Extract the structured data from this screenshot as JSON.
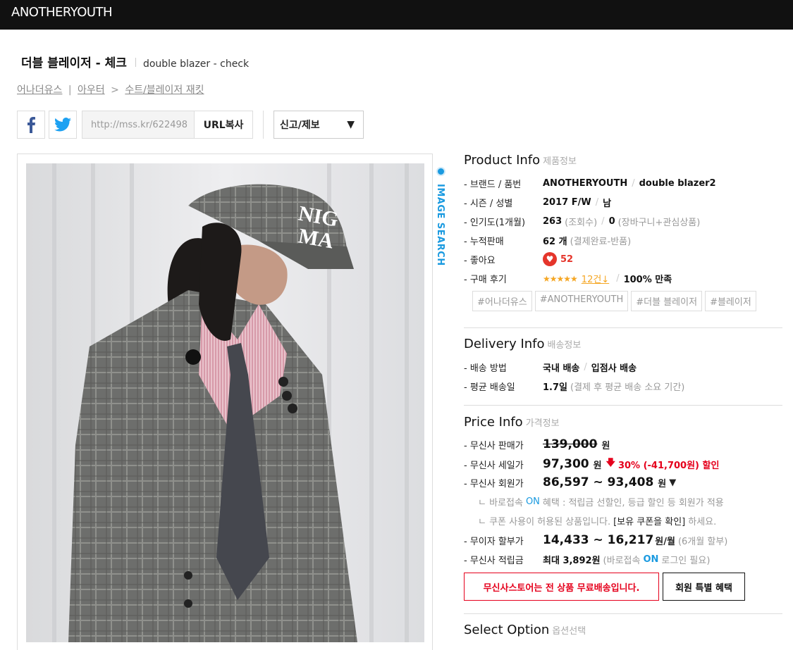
{
  "header": {
    "brand": "ANOTHERYOUTH"
  },
  "product": {
    "title_ko": "더블 블레이저 - 체크",
    "title_en": "double blazer - check"
  },
  "breadcrumb": {
    "items": [
      "어나더유스",
      "아우터",
      "수트/블레이저 재킷"
    ],
    "separators": [
      "|",
      ">"
    ]
  },
  "share": {
    "url": "http://mss.kr/622498",
    "url_copy_label": "URL복사",
    "report_label": "신고/제보",
    "report_arrow": "▼"
  },
  "image_search": {
    "label": "IMAGE SEARCH"
  },
  "product_info": {
    "title": "Product Info",
    "subtitle": "제품정보",
    "rows": [
      {
        "label": "- 브랜드 / 품번",
        "value": "ANOTHERYOUTH",
        "value2": "double blazer2"
      },
      {
        "label": "- 시즌 / 성별",
        "value": "2017 F/W",
        "value2": "남"
      },
      {
        "label": "- 인기도(1개월)",
        "value": "263",
        "note": "(조회수)",
        "value2": "0",
        "note2": "(장바구니+관심상품)"
      },
      {
        "label": "- 누적판매",
        "value": "62 개",
        "note": "(결제완료-반품)"
      },
      {
        "label": "- 좋아요",
        "value": "52"
      },
      {
        "label": "- 구매 후기",
        "stars": "★★★★★",
        "review_count": "12건↓",
        "value": "100% 만족"
      }
    ],
    "tags": [
      "#어나더유스",
      "#ANOTHERYOUTH",
      "#더블 블레이저",
      "#블레이저"
    ]
  },
  "delivery_info": {
    "title": "Delivery Info",
    "subtitle": "배송정보",
    "rows": [
      {
        "label": "- 배송 방법",
        "value": "국내 배송",
        "value2": "입점사 배송"
      },
      {
        "label": "- 평균 배송일",
        "value": "1.7일",
        "note": "(결제 후 평균 배송 소요 기간)"
      }
    ]
  },
  "price_info": {
    "title": "Price Info",
    "subtitle": "가격정보",
    "normal": {
      "label": "- 무신사 판매가",
      "price": "139,000",
      "unit": "원"
    },
    "sale": {
      "label": "- 무신사 세일가",
      "price": "97,300",
      "unit": "원",
      "discount": "30% (-41,700원) 할인"
    },
    "member": {
      "label": "- 무신사 회원가",
      "price": "86,597 ~ 93,408",
      "unit": "원",
      "arrow": "▼"
    },
    "note1_prefix": "ㄴ 바로접속",
    "note1_on": "ON",
    "note1_suffix": "혜택 : 적립금 선할인, 등급 할인 등 회원가 적용",
    "note2_prefix": "ㄴ 쿠폰 사용이 허용된 상품입니다.",
    "note2_link": "[보유 쿠폰을 확인]",
    "note2_suffix": "하세요.",
    "installment": {
      "label": "- 무이자 할부가",
      "price": "14,433 ~ 16,217",
      "unit": "원/월",
      "note": "(6개월 할부)"
    },
    "points": {
      "label": "- 무신사 적립금",
      "value": "최대 3,892원",
      "note_prefix": "(바로접속",
      "note_on": "ON",
      "note_suffix": "로그인 필요)"
    },
    "free_shipping_label": "무신사스토어는 전 상품 무료배송입니다.",
    "member_benefit_label": "회원 특별 혜택"
  },
  "select_option": {
    "title": "Select Option",
    "subtitle": "옵션선택"
  }
}
